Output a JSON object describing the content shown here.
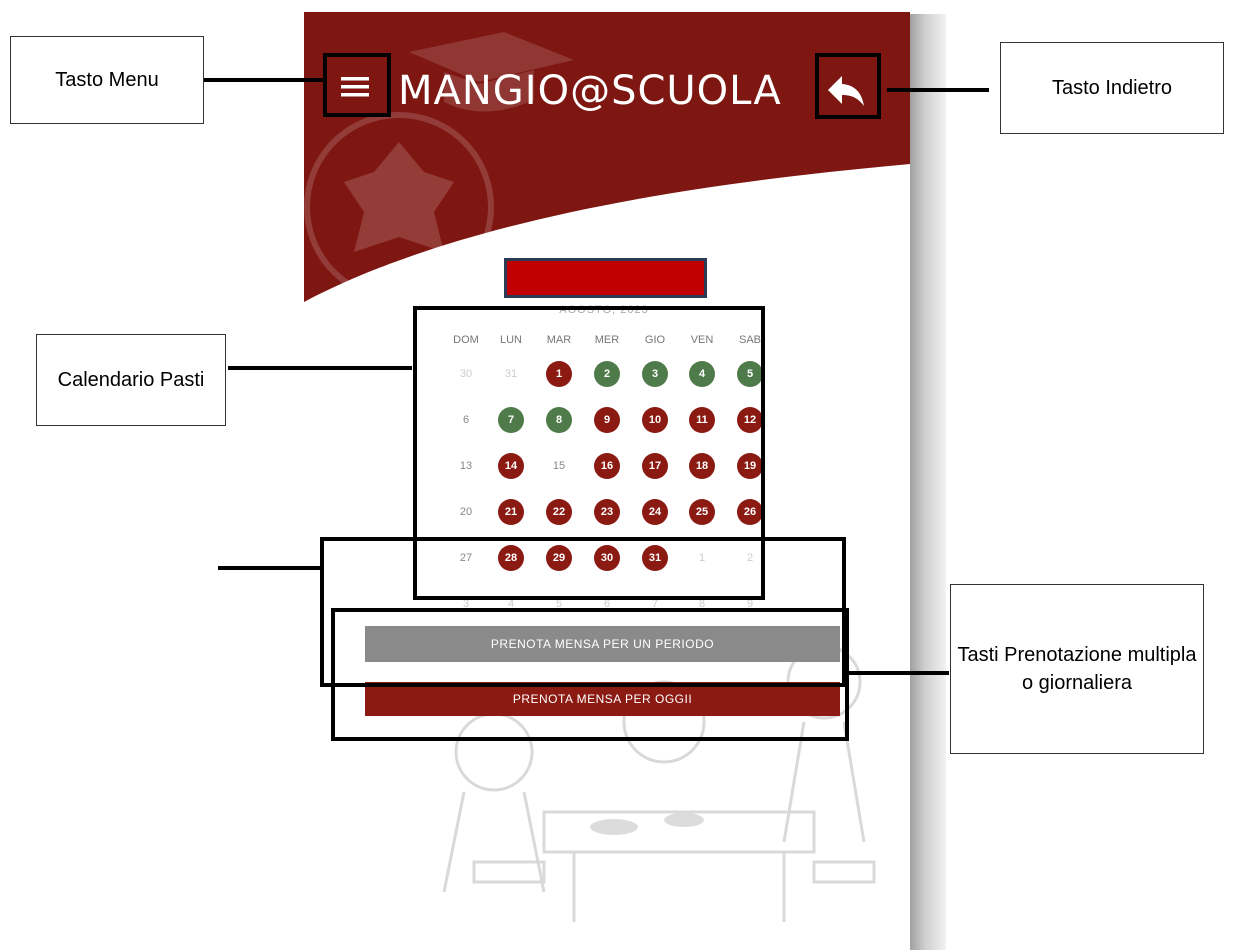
{
  "app": {
    "title": "MANGIO@SCUOLA"
  },
  "calendar": {
    "month": "AGOSTO, 2023",
    "weekdays": [
      "DOM",
      "LUN",
      "MAR",
      "MER",
      "GIO",
      "VEN",
      "SAB"
    ],
    "weeks": [
      [
        {
          "d": "30",
          "s": "muted"
        },
        {
          "d": "31",
          "s": "muted"
        },
        {
          "d": "1",
          "s": "red"
        },
        {
          "d": "2",
          "s": "green"
        },
        {
          "d": "3",
          "s": "green"
        },
        {
          "d": "4",
          "s": "green"
        },
        {
          "d": "5",
          "s": "green"
        }
      ],
      [
        {
          "d": "6",
          "s": "normal"
        },
        {
          "d": "7",
          "s": "green"
        },
        {
          "d": "8",
          "s": "green"
        },
        {
          "d": "9",
          "s": "red"
        },
        {
          "d": "10",
          "s": "red"
        },
        {
          "d": "11",
          "s": "red"
        },
        {
          "d": "12",
          "s": "red"
        }
      ],
      [
        {
          "d": "13",
          "s": "normal"
        },
        {
          "d": "14",
          "s": "red"
        },
        {
          "d": "15",
          "s": "normal"
        },
        {
          "d": "16",
          "s": "red"
        },
        {
          "d": "17",
          "s": "red"
        },
        {
          "d": "18",
          "s": "red"
        },
        {
          "d": "19",
          "s": "red"
        }
      ],
      [
        {
          "d": "20",
          "s": "normal"
        },
        {
          "d": "21",
          "s": "red"
        },
        {
          "d": "22",
          "s": "red"
        },
        {
          "d": "23",
          "s": "red"
        },
        {
          "d": "24",
          "s": "red"
        },
        {
          "d": "25",
          "s": "red"
        },
        {
          "d": "26",
          "s": "red"
        }
      ],
      [
        {
          "d": "27",
          "s": "normal"
        },
        {
          "d": "28",
          "s": "red"
        },
        {
          "d": "29",
          "s": "red"
        },
        {
          "d": "30",
          "s": "red"
        },
        {
          "d": "31",
          "s": "red"
        },
        {
          "d": "1",
          "s": "muted"
        },
        {
          "d": "2",
          "s": "muted"
        }
      ],
      [
        {
          "d": "3",
          "s": "muted"
        },
        {
          "d": "4",
          "s": "muted"
        },
        {
          "d": "5",
          "s": "muted"
        },
        {
          "d": "6",
          "s": "muted"
        },
        {
          "d": "7",
          "s": "muted"
        },
        {
          "d": "8",
          "s": "muted"
        },
        {
          "d": "9",
          "s": "muted"
        }
      ]
    ]
  },
  "buttons": {
    "period": "PRENOTA MENSA PER UN PERIODO",
    "today": "PRENOTA MENSA PER OGGII"
  },
  "annotations": {
    "menu": "Tasto Menu",
    "back": "Tasto Indietro",
    "calendar": "Calendario Pasti",
    "booking": "Tasti Prenotazione multipla o giornaliera"
  },
  "colors": {
    "brand_red": "#8b1a12",
    "booked_green": "#4f7a4a",
    "gray_button": "#8a8a8a"
  },
  "icons": {
    "menu": "hamburger-menu-icon",
    "back": "reply-arrow-icon"
  }
}
